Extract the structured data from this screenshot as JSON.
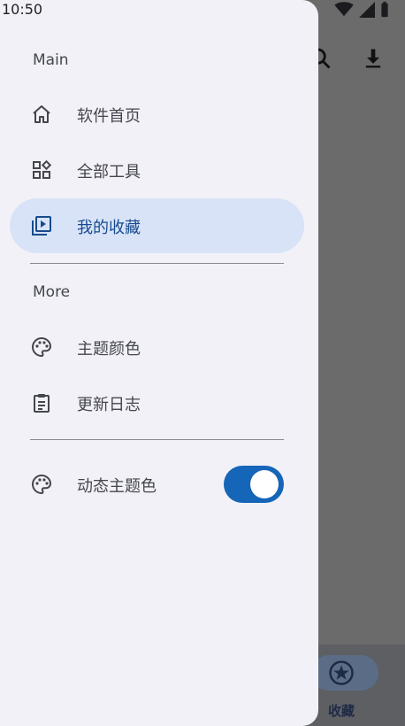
{
  "status_bar": {
    "time": "10:50"
  },
  "drawer": {
    "sections": [
      {
        "title": "Main"
      },
      {
        "title": "More"
      }
    ],
    "items": [
      {
        "label": "软件首页",
        "icon": "home-icon"
      },
      {
        "label": "全部工具",
        "icon": "grid-icon"
      },
      {
        "label": "我的收藏",
        "icon": "playlist-icon"
      },
      {
        "label": "主题颜色",
        "icon": "palette-icon"
      },
      {
        "label": "更新日志",
        "icon": "clipboard-icon"
      },
      {
        "label": "动态主题色",
        "icon": "palette-icon"
      }
    ],
    "dynamic_color_enabled": true
  },
  "bottom_nav": {
    "favorites_label": "收藏"
  },
  "colors": {
    "drawer_bg": "#f2f1f7",
    "active_item_bg": "#d8e3f7",
    "accent": "#1565b8",
    "text": "#44464f"
  }
}
